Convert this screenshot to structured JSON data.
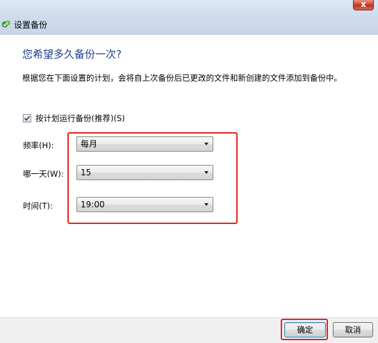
{
  "window": {
    "title": "设置备份",
    "close_glyph": "x"
  },
  "content": {
    "heading": "您希望多久备份一次?",
    "description": "根据您在下面设置的计划，会将自上次备份后已更改的文件和新创建的文件添加到备份中。",
    "schedule_checkbox": {
      "label": "按计划运行备份(推荐)(S)",
      "checked": true
    }
  },
  "fields": {
    "frequency": {
      "label": "频率(H):",
      "value": "每月"
    },
    "day": {
      "label": "哪一天(W):",
      "value": "15"
    },
    "time": {
      "label": "时间(T):",
      "value": "19:00"
    }
  },
  "buttons": {
    "ok": "确定",
    "cancel": "取消"
  },
  "colors": {
    "heading": "#1e3f8c",
    "highlight": "#e0261e"
  },
  "icons": {
    "app": "backup-app-icon",
    "dropdown": "chevron-down-icon",
    "check": "checkmark-icon"
  }
}
